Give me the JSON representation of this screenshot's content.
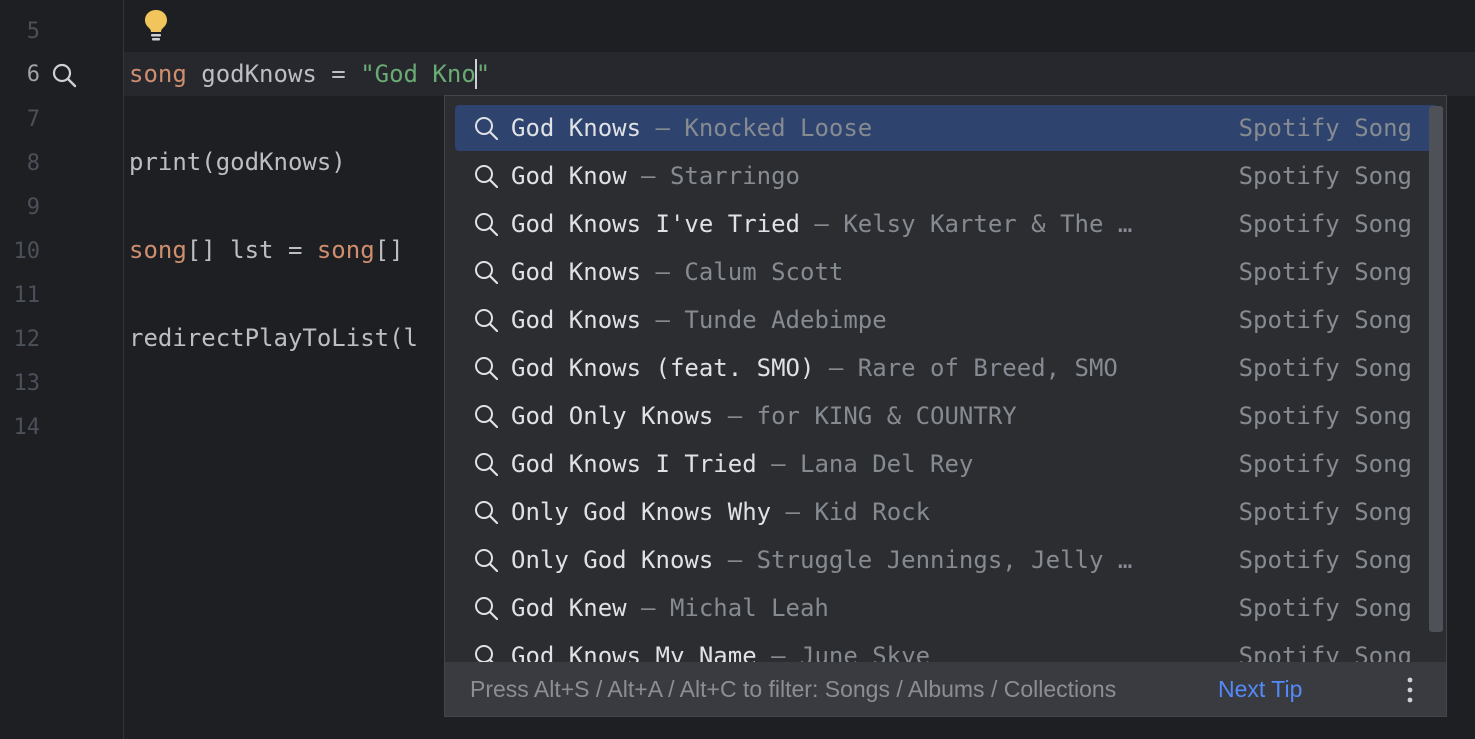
{
  "editor": {
    "line_numbers": [
      "5",
      "6",
      "7",
      "8",
      "9",
      "10",
      "11",
      "12",
      "13",
      "14"
    ],
    "current_line": "6",
    "lines": {
      "line6": {
        "kw": "song",
        "rest": " godKnows = ",
        "str_open": "\"God Kno",
        "str_close": "\""
      },
      "line8": "print(godKnows)",
      "line10": {
        "kw1": "song",
        "mid": "[] lst = ",
        "kw2": "song",
        "end": "[]"
      },
      "line12": "redirectPlayToList(l"
    },
    "icons": {
      "intention": "lightbulb-icon",
      "gutter": "search-icon"
    }
  },
  "completion": {
    "items": [
      {
        "title": "God Knows",
        "artist": " — Knocked Loose",
        "type": "Spotify Song",
        "selected": true
      },
      {
        "title": "God Know",
        "artist": " — Starringo",
        "type": "Spotify Song"
      },
      {
        "title": "God Knows I've Tried",
        "artist": " — Kelsy Karter & The …",
        "type": "Spotify Song"
      },
      {
        "title": "God Knows",
        "artist": " — Calum Scott",
        "type": "Spotify Song"
      },
      {
        "title": "God Knows",
        "artist": " — Tunde Adebimpe",
        "type": "Spotify Song"
      },
      {
        "title": "God Knows (feat. SMO)",
        "artist": " — Rare of Breed, SMO",
        "type": "Spotify Song"
      },
      {
        "title": "God Only Knows",
        "artist": " — for KING & COUNTRY",
        "type": "Spotify Song"
      },
      {
        "title": "God Knows I Tried",
        "artist": " — Lana Del Rey",
        "type": "Spotify Song"
      },
      {
        "title": "Only God Knows Why",
        "artist": " — Kid Rock",
        "type": "Spotify Song"
      },
      {
        "title": "Only God Knows",
        "artist": " — Struggle Jennings, Jelly …",
        "type": "Spotify Song"
      },
      {
        "title": "God Knew",
        "artist": " — Michal Leah",
        "type": "Spotify Song"
      },
      {
        "title": "God Knows My Name",
        "artist": " — June Skye",
        "type": "Spotify Song"
      }
    ],
    "footer": {
      "hint": "Press Alt+S / Alt+A / Alt+C to filter: Songs / Albums / Collections",
      "next_tip": "Next Tip"
    },
    "icons": {
      "item": "search-icon",
      "more": "more-vertical-icon"
    },
    "colors": {
      "selected_bg": "#2e436e",
      "link": "#548af7",
      "keyword": "#cf8e6d",
      "string": "#6aab73"
    }
  }
}
